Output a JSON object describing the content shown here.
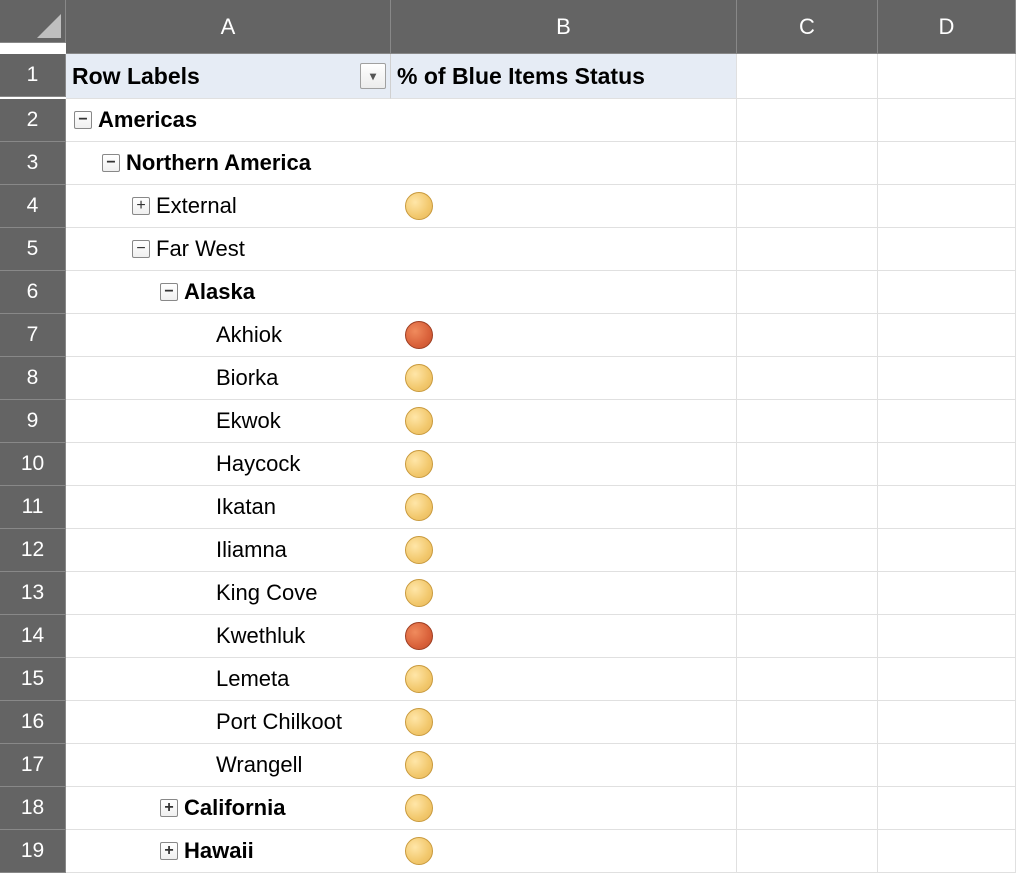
{
  "columns": {
    "a": "A",
    "b": "B",
    "c": "C",
    "d": "D"
  },
  "numbers": [
    "1",
    "2",
    "3",
    "4",
    "5",
    "6",
    "7",
    "8",
    "9",
    "10",
    "11",
    "12",
    "13",
    "14",
    "15",
    "16",
    "17",
    "18",
    "19"
  ],
  "header": {
    "rowLabels": "Row Labels",
    "pctBlue": "% of Blue Items Status"
  },
  "rows": [
    {
      "n": "1",
      "type": "title"
    },
    {
      "n": "2",
      "label": "Americas",
      "indent": 0,
      "bold": true,
      "expander": "minus",
      "status": null
    },
    {
      "n": "3",
      "label": "Northern America",
      "indent": 1,
      "bold": true,
      "expander": "minus",
      "status": null
    },
    {
      "n": "4",
      "label": "External",
      "indent": 2,
      "bold": false,
      "expander": "plus",
      "status": "yellow"
    },
    {
      "n": "5",
      "label": "Far West",
      "indent": 2,
      "bold": false,
      "expander": "minus",
      "status": null
    },
    {
      "n": "6",
      "label": "Alaska",
      "indent": 3,
      "bold": true,
      "expander": "minus",
      "status": null
    },
    {
      "n": "7",
      "label": "Akhiok",
      "indent": 4,
      "bold": false,
      "expander": null,
      "status": "red"
    },
    {
      "n": "8",
      "label": "Biorka",
      "indent": 4,
      "bold": false,
      "expander": null,
      "status": "yellow"
    },
    {
      "n": "9",
      "label": "Ekwok",
      "indent": 4,
      "bold": false,
      "expander": null,
      "status": "yellow"
    },
    {
      "n": "10",
      "label": "Haycock",
      "indent": 4,
      "bold": false,
      "expander": null,
      "status": "yellow"
    },
    {
      "n": "11",
      "label": "Ikatan",
      "indent": 4,
      "bold": false,
      "expander": null,
      "status": "yellow"
    },
    {
      "n": "12",
      "label": "Iliamna",
      "indent": 4,
      "bold": false,
      "expander": null,
      "status": "yellow"
    },
    {
      "n": "13",
      "label": "King Cove",
      "indent": 4,
      "bold": false,
      "expander": null,
      "status": "yellow"
    },
    {
      "n": "14",
      "label": "Kwethluk",
      "indent": 4,
      "bold": false,
      "expander": null,
      "status": "red"
    },
    {
      "n": "15",
      "label": "Lemeta",
      "indent": 4,
      "bold": false,
      "expander": null,
      "status": "yellow"
    },
    {
      "n": "16",
      "label": "Port Chilkoot",
      "indent": 4,
      "bold": false,
      "expander": null,
      "status": "yellow"
    },
    {
      "n": "17",
      "label": "Wrangell",
      "indent": 4,
      "bold": false,
      "expander": null,
      "status": "yellow"
    },
    {
      "n": "18",
      "label": "California",
      "indent": 3,
      "bold": true,
      "expander": "plus",
      "status": "yellow"
    },
    {
      "n": "19",
      "label": "Hawaii",
      "indent": 3,
      "bold": true,
      "expander": "plus",
      "status": "yellow"
    }
  ],
  "glyph": {
    "plus": "+",
    "minus": "−",
    "dropdown": "▾"
  }
}
